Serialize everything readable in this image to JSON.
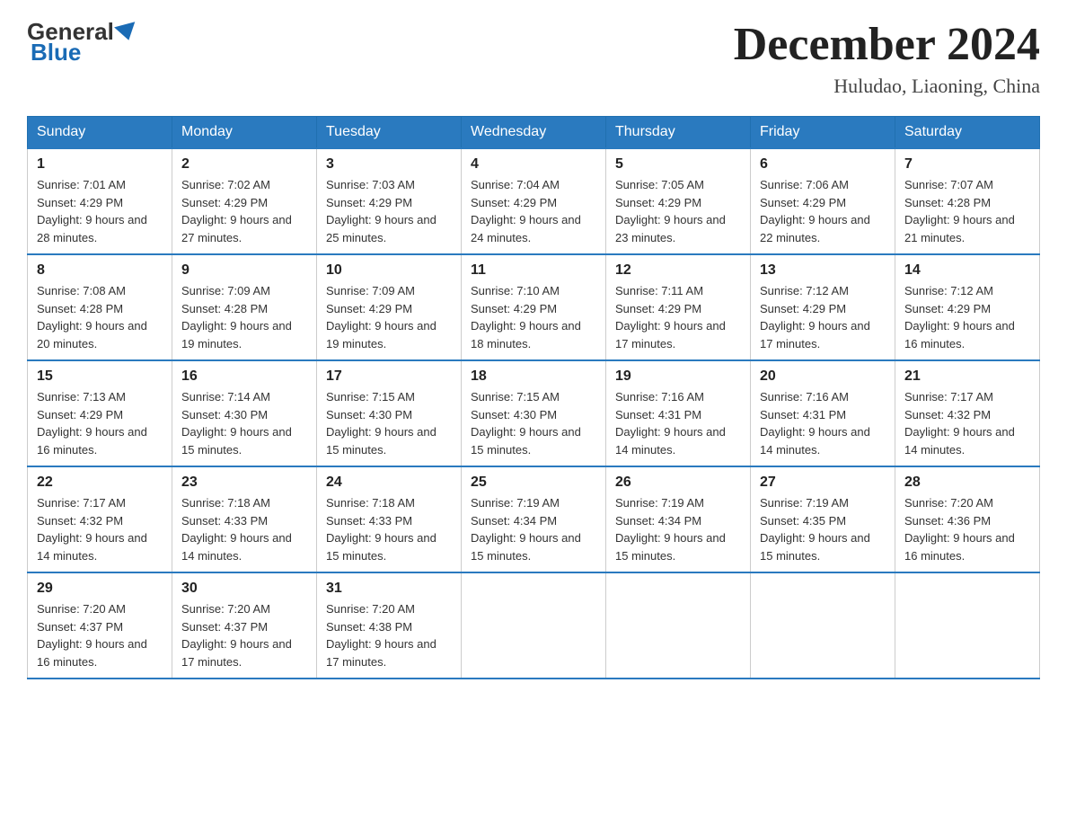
{
  "header": {
    "logo_general": "General",
    "logo_blue": "Blue",
    "month_title": "December 2024",
    "location": "Huludao, Liaoning, China"
  },
  "weekdays": [
    "Sunday",
    "Monday",
    "Tuesday",
    "Wednesday",
    "Thursday",
    "Friday",
    "Saturday"
  ],
  "weeks": [
    [
      {
        "day": "1",
        "sunrise": "7:01 AM",
        "sunset": "4:29 PM",
        "daylight": "9 hours and 28 minutes."
      },
      {
        "day": "2",
        "sunrise": "7:02 AM",
        "sunset": "4:29 PM",
        "daylight": "9 hours and 27 minutes."
      },
      {
        "day": "3",
        "sunrise": "7:03 AM",
        "sunset": "4:29 PM",
        "daylight": "9 hours and 25 minutes."
      },
      {
        "day": "4",
        "sunrise": "7:04 AM",
        "sunset": "4:29 PM",
        "daylight": "9 hours and 24 minutes."
      },
      {
        "day": "5",
        "sunrise": "7:05 AM",
        "sunset": "4:29 PM",
        "daylight": "9 hours and 23 minutes."
      },
      {
        "day": "6",
        "sunrise": "7:06 AM",
        "sunset": "4:29 PM",
        "daylight": "9 hours and 22 minutes."
      },
      {
        "day": "7",
        "sunrise": "7:07 AM",
        "sunset": "4:28 PM",
        "daylight": "9 hours and 21 minutes."
      }
    ],
    [
      {
        "day": "8",
        "sunrise": "7:08 AM",
        "sunset": "4:28 PM",
        "daylight": "9 hours and 20 minutes."
      },
      {
        "day": "9",
        "sunrise": "7:09 AM",
        "sunset": "4:28 PM",
        "daylight": "9 hours and 19 minutes."
      },
      {
        "day": "10",
        "sunrise": "7:09 AM",
        "sunset": "4:29 PM",
        "daylight": "9 hours and 19 minutes."
      },
      {
        "day": "11",
        "sunrise": "7:10 AM",
        "sunset": "4:29 PM",
        "daylight": "9 hours and 18 minutes."
      },
      {
        "day": "12",
        "sunrise": "7:11 AM",
        "sunset": "4:29 PM",
        "daylight": "9 hours and 17 minutes."
      },
      {
        "day": "13",
        "sunrise": "7:12 AM",
        "sunset": "4:29 PM",
        "daylight": "9 hours and 17 minutes."
      },
      {
        "day": "14",
        "sunrise": "7:12 AM",
        "sunset": "4:29 PM",
        "daylight": "9 hours and 16 minutes."
      }
    ],
    [
      {
        "day": "15",
        "sunrise": "7:13 AM",
        "sunset": "4:29 PM",
        "daylight": "9 hours and 16 minutes."
      },
      {
        "day": "16",
        "sunrise": "7:14 AM",
        "sunset": "4:30 PM",
        "daylight": "9 hours and 15 minutes."
      },
      {
        "day": "17",
        "sunrise": "7:15 AM",
        "sunset": "4:30 PM",
        "daylight": "9 hours and 15 minutes."
      },
      {
        "day": "18",
        "sunrise": "7:15 AM",
        "sunset": "4:30 PM",
        "daylight": "9 hours and 15 minutes."
      },
      {
        "day": "19",
        "sunrise": "7:16 AM",
        "sunset": "4:31 PM",
        "daylight": "9 hours and 14 minutes."
      },
      {
        "day": "20",
        "sunrise": "7:16 AM",
        "sunset": "4:31 PM",
        "daylight": "9 hours and 14 minutes."
      },
      {
        "day": "21",
        "sunrise": "7:17 AM",
        "sunset": "4:32 PM",
        "daylight": "9 hours and 14 minutes."
      }
    ],
    [
      {
        "day": "22",
        "sunrise": "7:17 AM",
        "sunset": "4:32 PM",
        "daylight": "9 hours and 14 minutes."
      },
      {
        "day": "23",
        "sunrise": "7:18 AM",
        "sunset": "4:33 PM",
        "daylight": "9 hours and 14 minutes."
      },
      {
        "day": "24",
        "sunrise": "7:18 AM",
        "sunset": "4:33 PM",
        "daylight": "9 hours and 15 minutes."
      },
      {
        "day": "25",
        "sunrise": "7:19 AM",
        "sunset": "4:34 PM",
        "daylight": "9 hours and 15 minutes."
      },
      {
        "day": "26",
        "sunrise": "7:19 AM",
        "sunset": "4:34 PM",
        "daylight": "9 hours and 15 minutes."
      },
      {
        "day": "27",
        "sunrise": "7:19 AM",
        "sunset": "4:35 PM",
        "daylight": "9 hours and 15 minutes."
      },
      {
        "day": "28",
        "sunrise": "7:20 AM",
        "sunset": "4:36 PM",
        "daylight": "9 hours and 16 minutes."
      }
    ],
    [
      {
        "day": "29",
        "sunrise": "7:20 AM",
        "sunset": "4:37 PM",
        "daylight": "9 hours and 16 minutes."
      },
      {
        "day": "30",
        "sunrise": "7:20 AM",
        "sunset": "4:37 PM",
        "daylight": "9 hours and 17 minutes."
      },
      {
        "day": "31",
        "sunrise": "7:20 AM",
        "sunset": "4:38 PM",
        "daylight": "9 hours and 17 minutes."
      },
      null,
      null,
      null,
      null
    ]
  ]
}
